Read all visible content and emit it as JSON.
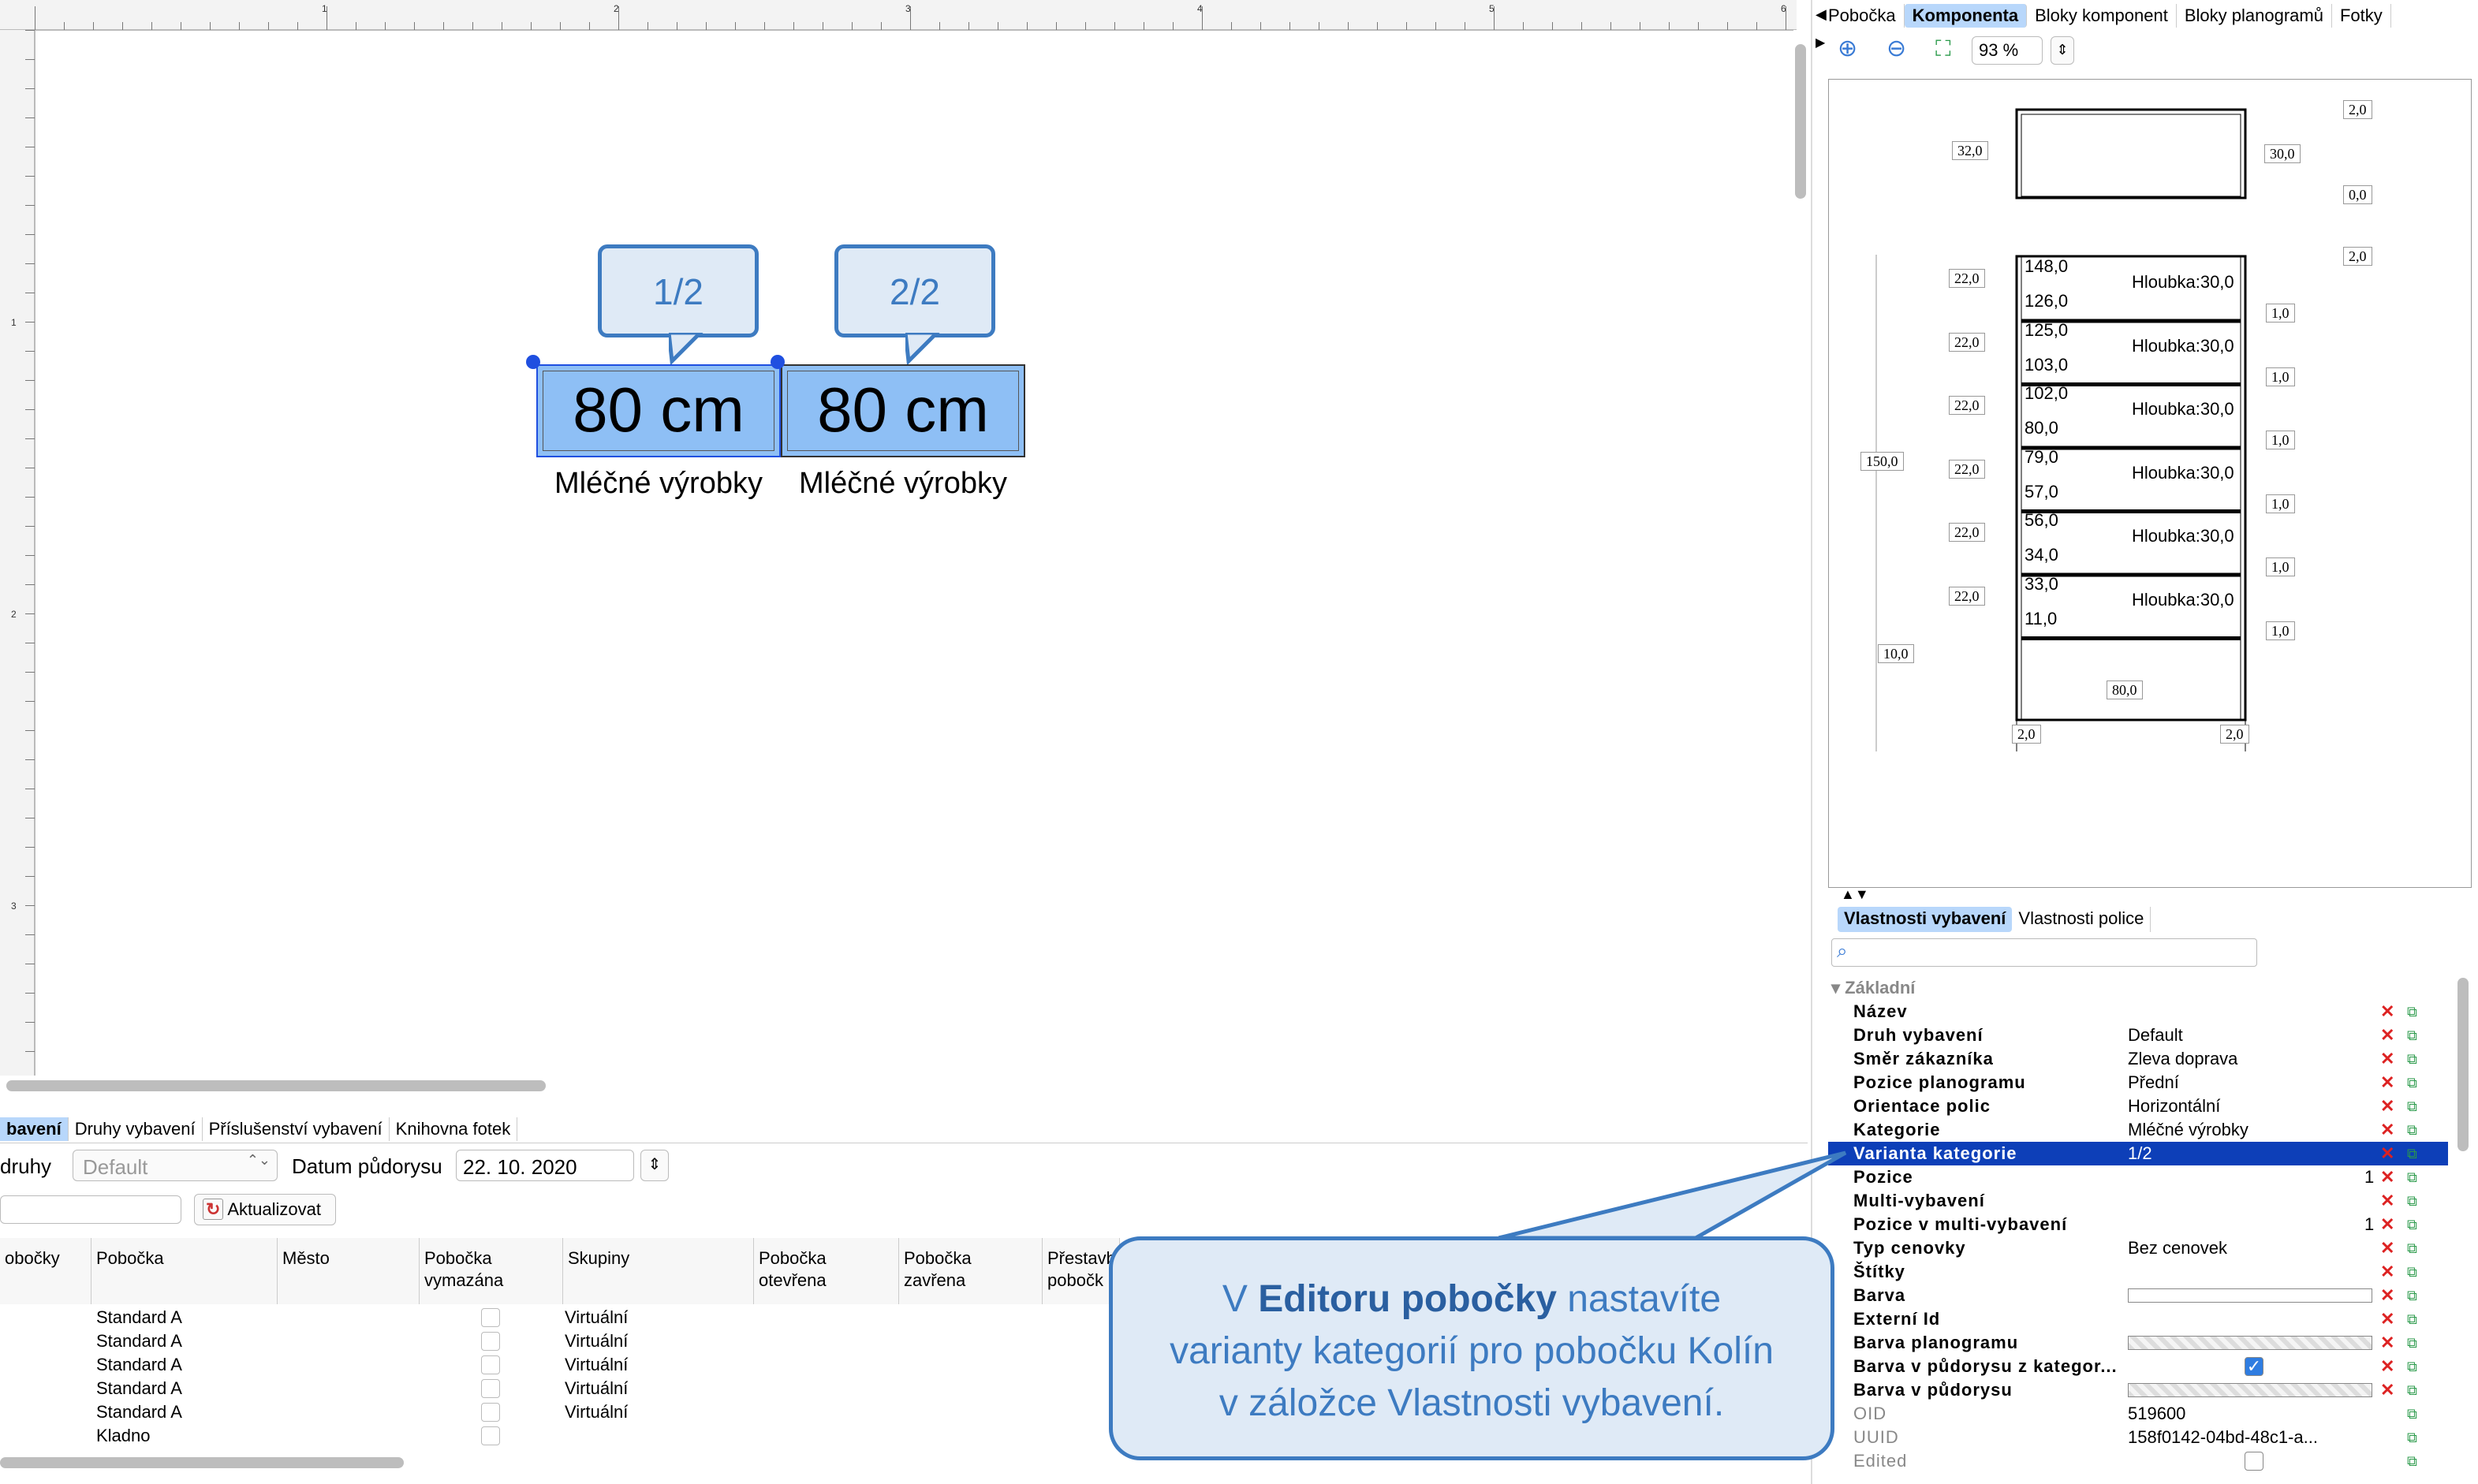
{
  "ruler": {
    "top_labels": [
      "1",
      "2",
      "3",
      "4",
      "5",
      "6"
    ],
    "left_labels": [
      "1",
      "2",
      "3"
    ]
  },
  "canvas": {
    "shelves": [
      {
        "size": "80 cm",
        "category": "Mléčné výrobky"
      },
      {
        "size": "80 cm",
        "category": "Mléčné výrobky"
      }
    ],
    "bubbles": [
      "1/2",
      "2/2"
    ]
  },
  "right_tabs": [
    "Pobočka",
    "Komponenta",
    "Bloky komponent",
    "Bloky planogramů",
    "Fotky"
  ],
  "right_tabs_active": "Komponenta",
  "zoom": {
    "value": "93 %"
  },
  "drawing": {
    "top_dims": {
      "d32": "32,0",
      "d30": "30,0",
      "d00": "0,0",
      "d20a": "2,0",
      "d20b": "2,0"
    },
    "shelves": [
      {
        "top": "148,0",
        "bottom": "126,0",
        "depth": "Hloubka:30,0",
        "gap": "22,0",
        "step": "1,0"
      },
      {
        "top": "125,0",
        "bottom": "103,0",
        "depth": "Hloubka:30,0",
        "gap": "22,0",
        "step": "1,0"
      },
      {
        "top": "102,0",
        "bottom": "80,0",
        "depth": "Hloubka:30,0",
        "gap": "22,0",
        "step": "1,0"
      },
      {
        "top": "79,0",
        "bottom": "57,0",
        "depth": "Hloubka:30,0",
        "gap": "22,0",
        "step": "1,0"
      },
      {
        "top": "56,0",
        "bottom": "34,0",
        "depth": "Hloubka:30,0",
        "gap": "22,0",
        "step": "1,0"
      },
      {
        "top": "33,0",
        "bottom": "11,0",
        "depth": "Hloubka:30,0",
        "gap": "22,0",
        "step": "1,0"
      }
    ],
    "total_height": "150,0",
    "base": "10,0",
    "width": "80,0",
    "leg_left": "2,0",
    "leg_right": "2,0"
  },
  "prop_tabs": [
    "Vlastnosti vybavení",
    "Vlastnosti police"
  ],
  "prop_group": "Základní",
  "properties": [
    {
      "k": "Název",
      "v": ""
    },
    {
      "k": "Druh vybavení",
      "v": "Default"
    },
    {
      "k": "Směr zákazníka",
      "v": "Zleva doprava"
    },
    {
      "k": "Pozice planogramu",
      "v": "Přední"
    },
    {
      "k": "Orientace polic",
      "v": "Horizontální"
    },
    {
      "k": "Kategorie",
      "v": "Mléčné výrobky"
    },
    {
      "k": "Varianta kategorie",
      "v": "1/2"
    },
    {
      "k": "Pozice",
      "v": "1"
    },
    {
      "k": "Multi-vybavení",
      "v": ""
    },
    {
      "k": "Pozice v multi-vybavení",
      "v": "1"
    },
    {
      "k": "Typ cenovky",
      "v": "Bez cenovek"
    },
    {
      "k": "Štítky",
      "v": ""
    },
    {
      "k": "Barva",
      "v": ""
    },
    {
      "k": "Externí Id",
      "v": ""
    },
    {
      "k": "Barva planogramu",
      "v": ""
    },
    {
      "k": "Barva v půdorysu z kategor...",
      "v": ""
    },
    {
      "k": "Barva v půdorysu",
      "v": ""
    },
    {
      "k": "OID",
      "v": "519600"
    },
    {
      "k": "UUID",
      "v": "158f0142-04bd-48c1-a..."
    },
    {
      "k": "Edited",
      "v": ""
    }
  ],
  "bottom_tabs": [
    "bavení",
    "Druhy vybavení",
    "Příslušenství vybavení",
    "Knihovna fotek"
  ],
  "filter": {
    "druhy_label": "druhy",
    "druhy_value": "Default",
    "date_label": "Datum půdorysu",
    "date_value": "22. 10. 2020",
    "refresh": "Aktualizovat"
  },
  "grid": {
    "headers": [
      "obočky",
      "Pobočka",
      "Město",
      "Pobočka vymazána",
      "Skupiny",
      "Pobočka otevřena",
      "Pobočka zavřena",
      "Přestavb pobočk"
    ],
    "rows": [
      {
        "pobocka": "Standard A",
        "skupiny": "Virtuální"
      },
      {
        "pobocka": "Standard A",
        "skupiny": "Virtuální"
      },
      {
        "pobocka": "Standard A",
        "skupiny": "Virtuální"
      },
      {
        "pobocka": "Standard A",
        "skupiny": "Virtuální"
      },
      {
        "pobocka": "Standard A",
        "skupiny": "Virtuální"
      },
      {
        "pobocka": "Kladno",
        "skupiny": ""
      }
    ]
  },
  "callout": {
    "line1_pre": "V ",
    "line1_bold": "Editoru pobočky",
    "line1_post": " nastavíte",
    "line2": "varianty kategorií pro pobočku Kolín",
    "line3": "v záložce Vlastnosti vybavení."
  },
  "colors": {
    "shelf_fill": "#8ebff5",
    "bubble_border": "#3d7bc1",
    "selection": "#0d3fb8",
    "callout_bg": "#dfeaf6"
  }
}
